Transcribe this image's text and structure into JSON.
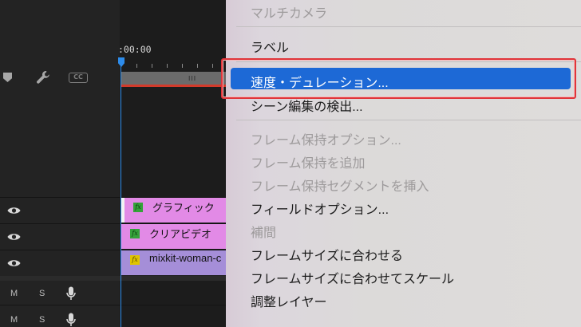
{
  "timeline": {
    "timecode": ":00:00",
    "tracks": [
      {
        "clip_label": "グラフィック",
        "fx": "fx",
        "color": "#e28ae6",
        "fx_bg": "#35a23a"
      },
      {
        "clip_label": "クリアビデオ",
        "fx": "fx",
        "color": "#e28ae6",
        "fx_bg": "#35a23a"
      },
      {
        "clip_label": "mixkit-woman-c",
        "fx": "fx",
        "color": "#a58ed8",
        "fx_bg": "#e0c400"
      }
    ],
    "audio_rows": [
      {
        "m": "M",
        "s": "S"
      },
      {
        "m": "M",
        "s": "S"
      }
    ],
    "cc_label": "CC",
    "work_area_grip": "III"
  },
  "menu": {
    "items": [
      {
        "label": "マルチカメラ",
        "disabled": true
      },
      {
        "label": "ラベル",
        "disabled": false
      },
      {
        "label": "速度・デュレーション...",
        "disabled": false,
        "selected": true
      },
      {
        "label": "シーン編集の検出...",
        "disabled": false
      },
      {
        "label": "フレーム保持オプション...",
        "disabled": true
      },
      {
        "label": "フレーム保持を追加",
        "disabled": true
      },
      {
        "label": "フレーム保持セグメントを挿入",
        "disabled": true
      },
      {
        "label": "フィールドオプション...",
        "disabled": false
      },
      {
        "label": "補間",
        "disabled": true
      },
      {
        "label": "フレームサイズに合わせる",
        "disabled": false
      },
      {
        "label": "フレームサイズに合わせてスケール",
        "disabled": false
      },
      {
        "label": "調整レイヤー",
        "disabled": false
      }
    ]
  },
  "colors": {
    "accent": "#1d69d6",
    "playhead": "#2d8ceb",
    "focus_outline": "#e0353a"
  }
}
